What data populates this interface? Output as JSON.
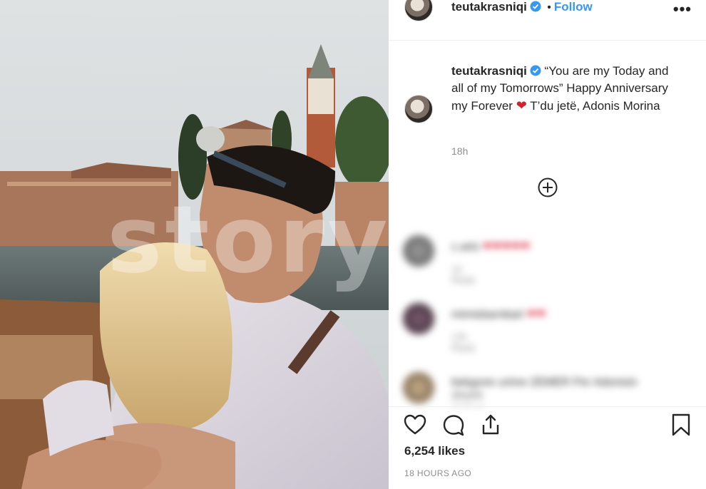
{
  "post": {
    "username": "teutakrasniqi",
    "follow_label": "Follow",
    "separator": "•",
    "more_icon": "more-options-icon",
    "caption_username": "teutakrasniqi",
    "caption_part1": "“You are my Today and all of my Tomorrows” Happy Anniversary my Forever",
    "caption_part2": "T’du jetë, Adonis Morina",
    "caption_time": "18h",
    "load_more_icon": "plus-circle-icon",
    "likes": "6,254 likes",
    "posted_ago": "18 HOURS AGO"
  },
  "watermark": "story.al",
  "comments": [
    {
      "text": "c.arts",
      "meta": "1d   Reply"
    },
    {
      "text": "mimisbarnbart",
      "meta": "13h   Reply"
    },
    {
      "text": "bekgone urime ZEMER Per Adonisin",
      "meta": "shumt pjeken bashk"
    }
  ],
  "colors": {
    "accent": "#3897f0",
    "heart": "#d4212a",
    "muted": "#8e8e8e"
  }
}
